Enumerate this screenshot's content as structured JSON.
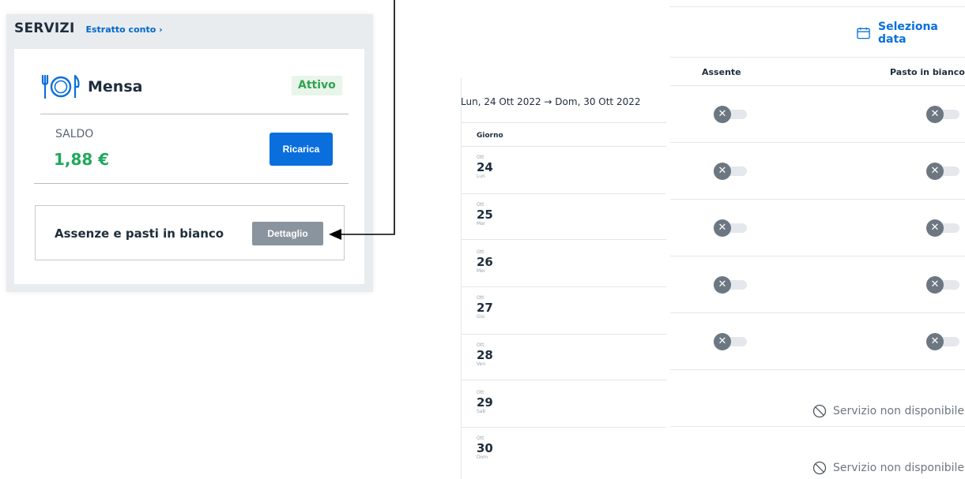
{
  "servizi": {
    "title": "SERVIZI",
    "estratto_link": "Estratto conto ›",
    "mensa": {
      "icon": "plate-fork-knife-icon",
      "title": "Mensa",
      "status": "Attivo",
      "saldo_label": "SALDO",
      "saldo_value": "1,88 €",
      "ricarica_label": "Ricarica",
      "assenze_label": "Assenze e pasti in bianco",
      "dettaglio_label": "Dettaglio"
    }
  },
  "calendar": {
    "seleziona_label": "Seleziona data",
    "range": "Lun, 24 Ott 2022  →  Dom, 30 Ott 2022",
    "giorno_header": "Giorno",
    "col_assente": "Assente",
    "col_pasto": "Pasto in bianco",
    "unavailable_label": "Servizio non disponibile",
    "days": [
      {
        "month": "Ott",
        "num": "24",
        "weekday": "Lun",
        "available": true
      },
      {
        "month": "Ott",
        "num": "25",
        "weekday": "Mar",
        "available": true
      },
      {
        "month": "Ott",
        "num": "26",
        "weekday": "Mer",
        "available": true
      },
      {
        "month": "Ott",
        "num": "27",
        "weekday": "Gio",
        "available": true
      },
      {
        "month": "Ott",
        "num": "28",
        "weekday": "Ven",
        "available": true
      },
      {
        "month": "Ott",
        "num": "29",
        "weekday": "Sab",
        "available": false
      },
      {
        "month": "Ott",
        "num": "30",
        "weekday": "Dom",
        "available": false
      }
    ]
  },
  "colors": {
    "primary": "#0a6fdc",
    "success": "#1fa95a",
    "toggle_off": "#6c7782"
  }
}
